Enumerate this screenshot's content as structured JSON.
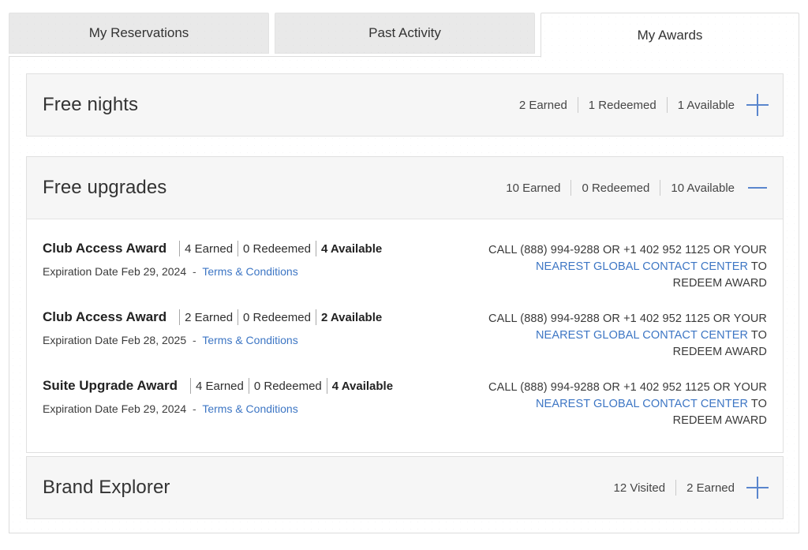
{
  "tabs": [
    {
      "label": "My Reservations",
      "active": false
    },
    {
      "label": "Past Activity",
      "active": false
    },
    {
      "label": "My Awards",
      "active": true
    }
  ],
  "sections": {
    "free_nights": {
      "title": "Free nights",
      "stats": [
        "2 Earned",
        "1 Redeemed",
        "1 Available"
      ],
      "toggle_icon": "plus-icon",
      "expanded": false
    },
    "free_upgrades": {
      "title": "Free upgrades",
      "stats": [
        "10 Earned",
        "0 Redeemed",
        "10 Available"
      ],
      "toggle_icon": "minus-icon",
      "expanded": true,
      "awards": [
        {
          "name": "Club Access Award",
          "earned": "4 Earned",
          "redeemed": "0 Redeemed",
          "available": "4 Available",
          "expiration": "Expiration Date Feb 29, 2024",
          "dash": "-",
          "terms_label": "Terms & Conditions",
          "redeem_pre": "CALL (888) 994-9288 OR +1 402 952 1125 OR YOUR ",
          "redeem_link": "NEAREST GLOBAL CONTACT CENTER",
          "redeem_post": " TO REDEEM AWARD"
        },
        {
          "name": "Club Access Award",
          "earned": "2 Earned",
          "redeemed": "0 Redeemed",
          "available": "2 Available",
          "expiration": "Expiration Date Feb 28, 2025",
          "dash": "-",
          "terms_label": "Terms & Conditions",
          "redeem_pre": "CALL (888) 994-9288 OR +1 402 952 1125 OR YOUR ",
          "redeem_link": "NEAREST GLOBAL CONTACT CENTER",
          "redeem_post": " TO REDEEM AWARD"
        },
        {
          "name": "Suite Upgrade Award",
          "earned": "4 Earned",
          "redeemed": "0 Redeemed",
          "available": "4 Available",
          "expiration": "Expiration Date Feb 29, 2024",
          "dash": "-",
          "terms_label": "Terms & Conditions",
          "redeem_pre": "CALL (888) 994-9288 OR +1 402 952 1125 OR YOUR ",
          "redeem_link": "NEAREST GLOBAL CONTACT CENTER",
          "redeem_post": " TO REDEEM AWARD"
        }
      ]
    },
    "brand_explorer": {
      "title": "Brand Explorer",
      "stats": [
        "12 Visited",
        "2 Earned"
      ],
      "toggle_icon": "plus-icon",
      "expanded": false
    }
  },
  "colors": {
    "accent_blue": "#5a86cd",
    "link_blue": "#3d76c4",
    "card_bg": "#f6f6f6",
    "tab_inactive_bg": "#e9e9e9",
    "border": "#dcdcdc"
  }
}
